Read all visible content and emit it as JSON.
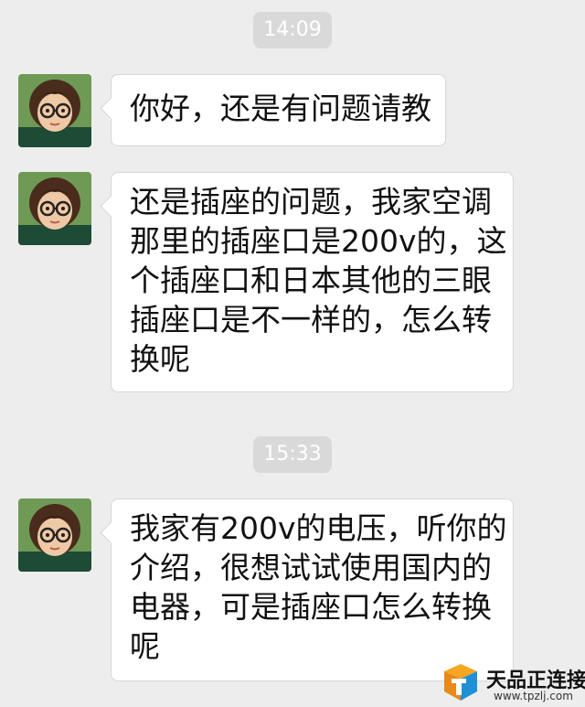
{
  "timestamps": [
    "14:09",
    "15:33"
  ],
  "messages": [
    {
      "sender_avatar": "child-with-glasses-avatar",
      "lines": [
        "你好，还是有问题请教"
      ]
    },
    {
      "sender_avatar": "child-with-glasses-avatar",
      "lines": [
        "还是插座的问题，我家空调",
        "那里的插座口是200v的，这",
        "个插座口和日本其他的三眼",
        "插座口是不一样的，怎么转",
        "换呢"
      ]
    },
    {
      "sender_avatar": "child-with-glasses-avatar",
      "lines": [
        "我家有200v的电压，听你的",
        "介绍，很想试试使用国内的",
        "电器，可是插座口怎么转换",
        "呢"
      ]
    }
  ],
  "watermark": {
    "name": "天品正连接",
    "url": "www.tpzlj.com"
  },
  "colors": {
    "background": "#ededed",
    "bubble": "#ffffff",
    "time_pill": "#d9d9d9"
  }
}
